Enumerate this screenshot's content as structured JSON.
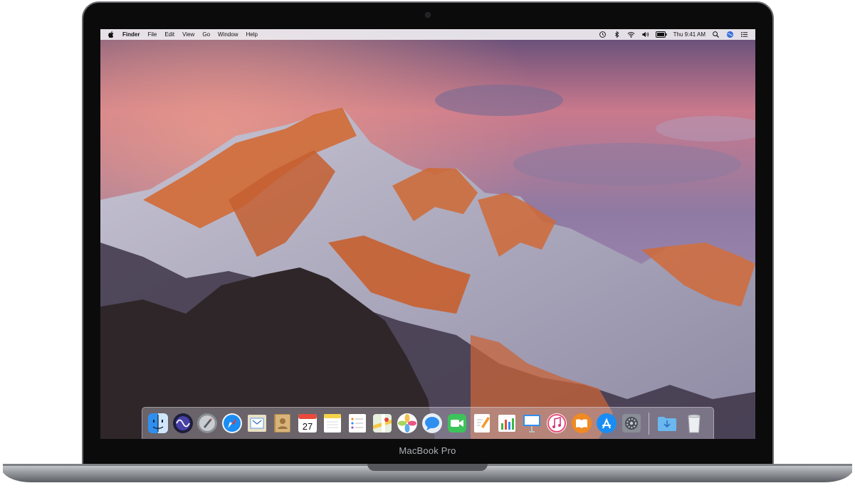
{
  "device": {
    "brand_label": "MacBook Pro"
  },
  "menubar": {
    "apple_icon": "apple-icon",
    "items": [
      {
        "label": "Finder"
      },
      {
        "label": "File"
      },
      {
        "label": "Edit"
      },
      {
        "label": "View"
      },
      {
        "label": "Go"
      },
      {
        "label": "Window"
      },
      {
        "label": "Help"
      }
    ],
    "status_icons": [
      "time-machine-icon",
      "bluetooth-icon",
      "wifi-icon",
      "volume-icon",
      "battery-icon"
    ],
    "clock": "Thu 9:41 AM",
    "right_icons": [
      "spotlight-icon",
      "siri-icon",
      "notification-center-icon"
    ]
  },
  "dock": {
    "apps": [
      "finder",
      "siri",
      "launchpad",
      "safari",
      "mail",
      "contacts",
      "calendar",
      "notes",
      "reminders",
      "maps",
      "photos",
      "messages",
      "facetime",
      "pages",
      "numbers",
      "keynote",
      "itunes",
      "ibooks",
      "app-store",
      "system-preferences"
    ],
    "calendar_day": "27",
    "folders": [
      "downloads-folder",
      "trash"
    ]
  }
}
